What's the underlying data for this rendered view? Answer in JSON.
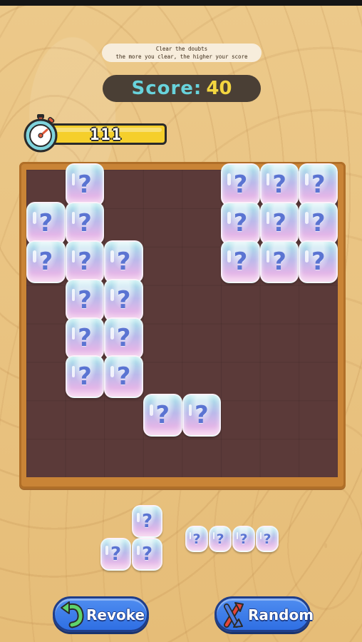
{
  "hint": {
    "line1": "Clear the doubts",
    "line2": "the more you clear, the higher your score"
  },
  "score": {
    "label": "Score:",
    "value": "40"
  },
  "timer": {
    "value": "111"
  },
  "block": {
    "glyph": "?"
  },
  "buttons": {
    "revoke": "Revoke",
    "random": "Random"
  },
  "board": {
    "rows": 8,
    "cols": 8,
    "filled_cells": [
      [
        0,
        1
      ],
      [
        0,
        5
      ],
      [
        0,
        6
      ],
      [
        0,
        7
      ],
      [
        1,
        0
      ],
      [
        1,
        1
      ],
      [
        1,
        5
      ],
      [
        1,
        6
      ],
      [
        1,
        7
      ],
      [
        2,
        0
      ],
      [
        2,
        1
      ],
      [
        2,
        2
      ],
      [
        2,
        5
      ],
      [
        2,
        6
      ],
      [
        2,
        7
      ],
      [
        3,
        1
      ],
      [
        3,
        2
      ],
      [
        4,
        1
      ],
      [
        4,
        2
      ],
      [
        5,
        1
      ],
      [
        5,
        2
      ],
      [
        6,
        3
      ],
      [
        6,
        4
      ]
    ]
  },
  "tray": {
    "piece1_cells": [
      [
        0,
        1
      ],
      [
        1,
        0
      ],
      [
        1,
        1
      ]
    ],
    "piece2_cells": [
      [
        0,
        0
      ],
      [
        0,
        1
      ],
      [
        0,
        2
      ],
      [
        0,
        3
      ]
    ]
  },
  "colors": {
    "board": "#5b3a39",
    "frame": "#c98436",
    "score_label": "#68d3dc",
    "score_value": "#f3d640",
    "timer_bar": "#f5cf2b",
    "button": "#2f6fe3"
  }
}
